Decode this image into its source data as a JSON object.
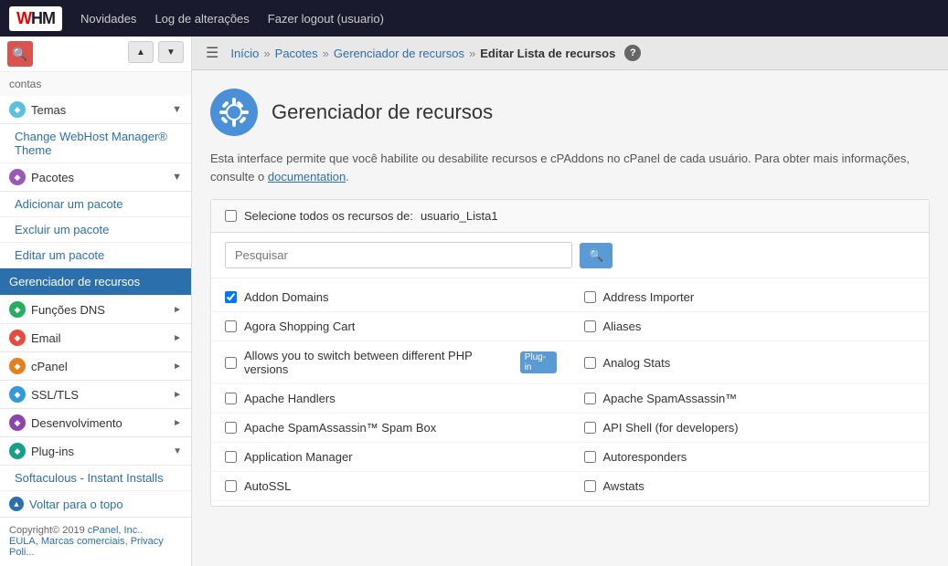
{
  "topnav": {
    "logo": "WHM",
    "links": [
      "Novidades",
      "Log de alterações",
      "Fazer logout (usuario)"
    ]
  },
  "sidebar": {
    "section_contas": "contas",
    "temas_label": "Temas",
    "change_webhost_label": "Change WebHost Manager® Theme",
    "pacotes_label": "Pacotes",
    "pacotes_links": [
      "Adicionar um pacote",
      "Excluir um pacote",
      "Editar um pacote",
      "Gerenciador de recursos"
    ],
    "funcoes_dns": "Funções DNS",
    "email": "Email",
    "cpanel": "cPanel",
    "ssl_tls": "SSL/TLS",
    "desenvolvimento": "Desenvolvimento",
    "plugins": "Plug-ins",
    "softaculous": "Softaculous - Instant Installs",
    "voltar_topo": "Voltar para o topo",
    "copyright": "Copyright© 2019",
    "cpanel_link": "cPanel, Inc.",
    "eula": "EULA",
    "marcas": "Marcas comerciais",
    "privacy": "Privacy Poli..."
  },
  "breadcrumb": {
    "inicio": "Início",
    "pacotes": "Pacotes",
    "gerenciador": "Gerenciador de recursos",
    "current": "Editar Lista de recursos"
  },
  "page": {
    "title": "Gerenciador de recursos",
    "description": "Esta interface permite que você habilite ou desabilite recursos e cPAddons no cPanel de cada usuário. Para obter mais informações, consulte o",
    "doc_link": "documentation",
    "select_all_label": "Selecione todos os recursos de:",
    "list_name": "usuario_Lista1",
    "search_placeholder": "Pesquisar",
    "search_btn": "🔍"
  },
  "features": [
    {
      "name": "Addon Domains",
      "checked": true,
      "plugin": false,
      "col": 0
    },
    {
      "name": "Address Importer",
      "checked": false,
      "plugin": false,
      "col": 1
    },
    {
      "name": "Agora Shopping Cart",
      "checked": false,
      "plugin": false,
      "col": 0
    },
    {
      "name": "Aliases",
      "checked": false,
      "plugin": false,
      "col": 1
    },
    {
      "name": "Allows you to switch between different PHP versions",
      "checked": false,
      "plugin": true,
      "col": 0
    },
    {
      "name": "Analog Stats",
      "checked": false,
      "plugin": false,
      "col": 1
    },
    {
      "name": "Apache Handlers",
      "checked": false,
      "plugin": false,
      "col": 0
    },
    {
      "name": "Apache SpamAssassin™",
      "checked": false,
      "plugin": false,
      "col": 1
    },
    {
      "name": "Apache SpamAssassin™ Spam Box",
      "checked": false,
      "plugin": false,
      "col": 0
    },
    {
      "name": "API Shell (for developers)",
      "checked": false,
      "plugin": false,
      "col": 1
    },
    {
      "name": "Application Manager",
      "checked": false,
      "plugin": false,
      "col": 0
    },
    {
      "name": "Autoresponders",
      "checked": false,
      "plugin": false,
      "col": 1
    },
    {
      "name": "AutoSSL",
      "checked": false,
      "plugin": false,
      "col": 0
    },
    {
      "name": "Awstats",
      "checked": false,
      "plugin": false,
      "col": 1
    }
  ],
  "plugin_badge_label": "Plug-in"
}
